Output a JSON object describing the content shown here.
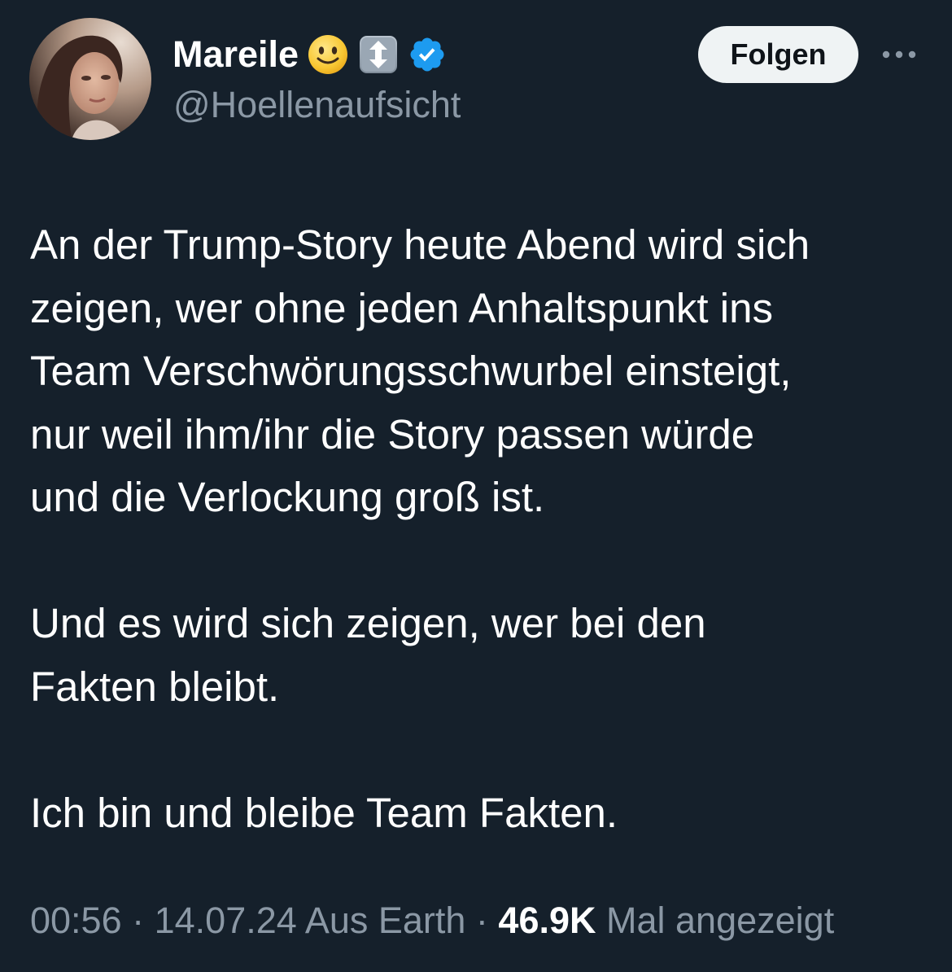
{
  "author": {
    "display_name": "Mareile",
    "handle": "@Hoellenaufsicht",
    "avatar_icon": "profile-photo",
    "badges": [
      "slightly-smiling-face-emoji",
      "up-down-arrow-emoji",
      "verified-badge"
    ],
    "verified_color": "#1d9bf0"
  },
  "actions": {
    "follow_label": "Folgen",
    "more_icon": "more-dots-icon"
  },
  "tweet": {
    "lines_p1": [
      "An der Trump-Story heute Abend wird sich",
      "zeigen, wer ohne jeden Anhaltspunkt ins",
      "Team Verschwörungsschwurbel einsteigt,",
      "nur weil ihm/ihr die Story passen würde",
      "und die Verlockung groß ist."
    ],
    "lines_p2": [
      "Und es wird sich zeigen, wer bei den",
      "Fakten bleibt."
    ],
    "lines_p3": [
      "Ich bin und bleibe Team Fakten."
    ]
  },
  "meta": {
    "time": "00:56",
    "sep1": " · ",
    "date": "14.07.24",
    "location": " Aus Earth",
    "sep2": " · ",
    "views_count": "46.9K",
    "views_label": " Mal angezeigt"
  },
  "colors": {
    "background": "#15202b",
    "text_primary": "#ffffff",
    "text_secondary": "#8b98a5",
    "button_bg": "#eff3f4",
    "button_text": "#0f1419"
  }
}
